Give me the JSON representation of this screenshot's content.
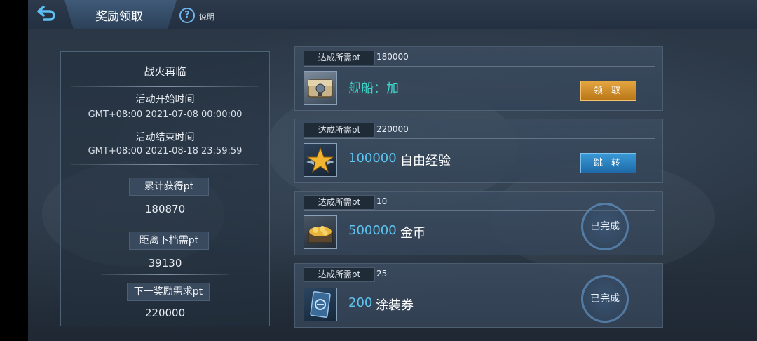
{
  "header": {
    "title": "奖励领取",
    "help_label": "说明"
  },
  "event": {
    "name": "战火再临",
    "start_label": "活动开始时间",
    "start_time": "GMT+08:00 2021-07-08 00:00:00",
    "end_label": "活动结束时间",
    "end_time": "GMT+08:00 2021-08-18 23:59:59",
    "total_label": "累计获得pt",
    "total_value": "180870",
    "next_tier_label": "距离下档需pt",
    "next_tier_value": "39130",
    "next_reward_label": "下一奖励需求pt",
    "next_reward_value": "220000"
  },
  "rewards": [
    {
      "req_label": "达成所需pt",
      "req_value": "180000",
      "icon": "treasure-chest-icon",
      "amount": "",
      "name": "舰船：加",
      "action": "领 取",
      "state": "claimable"
    },
    {
      "req_label": "达成所需pt",
      "req_value": "220000",
      "icon": "star-badge-icon",
      "amount": "100000",
      "name": "自由经验",
      "action": "跳 转",
      "state": "goto"
    },
    {
      "req_label": "达成所需pt",
      "req_value": "10",
      "icon": "gold-coins-icon",
      "amount": "500000",
      "name": "金币",
      "action": "已完成",
      "state": "completed"
    },
    {
      "req_label": "达成所需pt",
      "req_value": "25",
      "icon": "camouflage-ticket-icon",
      "amount": "200",
      "name": "涂装券",
      "action": "已完成",
      "state": "completed"
    }
  ],
  "colors": {
    "accent_blue": "#5ec3f0",
    "claim_gold": "#d08d2a",
    "goto_blue": "#2a82c0",
    "ship_name_cyan": "#3ed4c8"
  }
}
